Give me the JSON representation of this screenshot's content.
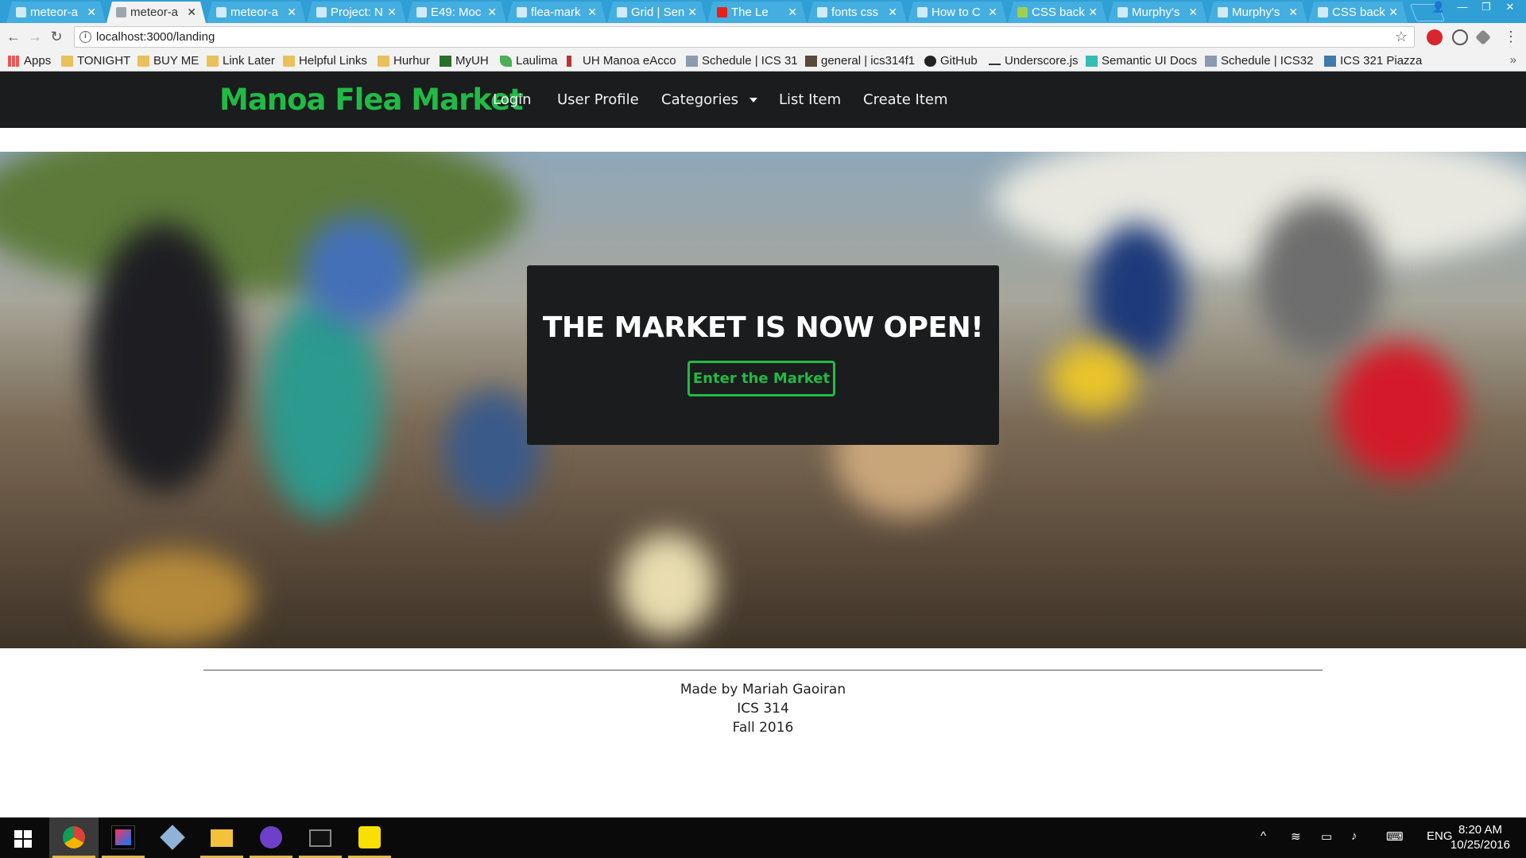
{
  "browser": {
    "tabs": [
      {
        "title": "meteor-a",
        "active": false
      },
      {
        "title": "meteor-a",
        "active": true
      },
      {
        "title": "meteor-a",
        "active": false
      },
      {
        "title": "Project: N",
        "active": false
      },
      {
        "title": "E49: Moc",
        "active": false
      },
      {
        "title": "flea-mark",
        "active": false
      },
      {
        "title": "Grid | Sen",
        "active": false
      },
      {
        "title": "The Le",
        "active": false
      },
      {
        "title": "fonts css",
        "active": false
      },
      {
        "title": "How to C",
        "active": false
      },
      {
        "title": "CSS back",
        "active": false
      },
      {
        "title": "Murphy's",
        "active": false
      },
      {
        "title": "Murphy's",
        "active": false
      },
      {
        "title": "CSS back",
        "active": false
      }
    ],
    "url": "localhost:3000/landing",
    "bookmarks": [
      {
        "label": "Apps",
        "icon": "apps-icon"
      },
      {
        "label": "TONIGHT",
        "icon": "folder-icon"
      },
      {
        "label": "BUY ME",
        "icon": "folder-icon"
      },
      {
        "label": "Link Later",
        "icon": "folder-icon"
      },
      {
        "label": "Helpful Links",
        "icon": "folder-icon"
      },
      {
        "label": "Hurhur",
        "icon": "folder-icon"
      },
      {
        "label": "MyUH",
        "icon": "uh-icon"
      },
      {
        "label": "Laulima",
        "icon": "leaf-icon"
      },
      {
        "label": "UH Manoa eAcco",
        "icon": "uh-icon"
      },
      {
        "label": "Schedule | ICS 31",
        "icon": "page-icon"
      },
      {
        "label": "general | ics314f1",
        "icon": "slack-icon"
      },
      {
        "label": "GitHub",
        "icon": "github-icon"
      },
      {
        "label": "Underscore.js",
        "icon": "underscore-icon"
      },
      {
        "label": "Semantic UI Docs",
        "icon": "semantic-icon"
      },
      {
        "label": "Schedule | ICS32",
        "icon": "page-icon"
      },
      {
        "label": "ICS 321 Piazza",
        "icon": "piazza-icon"
      }
    ]
  },
  "site": {
    "brand": "Manoa Flea Market",
    "nav": [
      {
        "label": "Login"
      },
      {
        "label": "User Profile"
      },
      {
        "label": "Categories"
      },
      {
        "label": "List Item"
      },
      {
        "label": "Create Item"
      }
    ],
    "hero": {
      "headline": "THE MARKET IS NOW OPEN!",
      "button_label": "Enter the Market"
    },
    "footer": {
      "line1": "Made by Mariah Gaoiran",
      "line2": "ICS 314",
      "line3": "Fall 2016"
    }
  },
  "taskbar": {
    "language": "ENG",
    "time": "8:20 AM",
    "date": "10/25/2016"
  },
  "colors": {
    "brand_green": "#21ba45",
    "nav_bg": "#1b1c1d",
    "tab_strip": "#2f9fd6"
  }
}
